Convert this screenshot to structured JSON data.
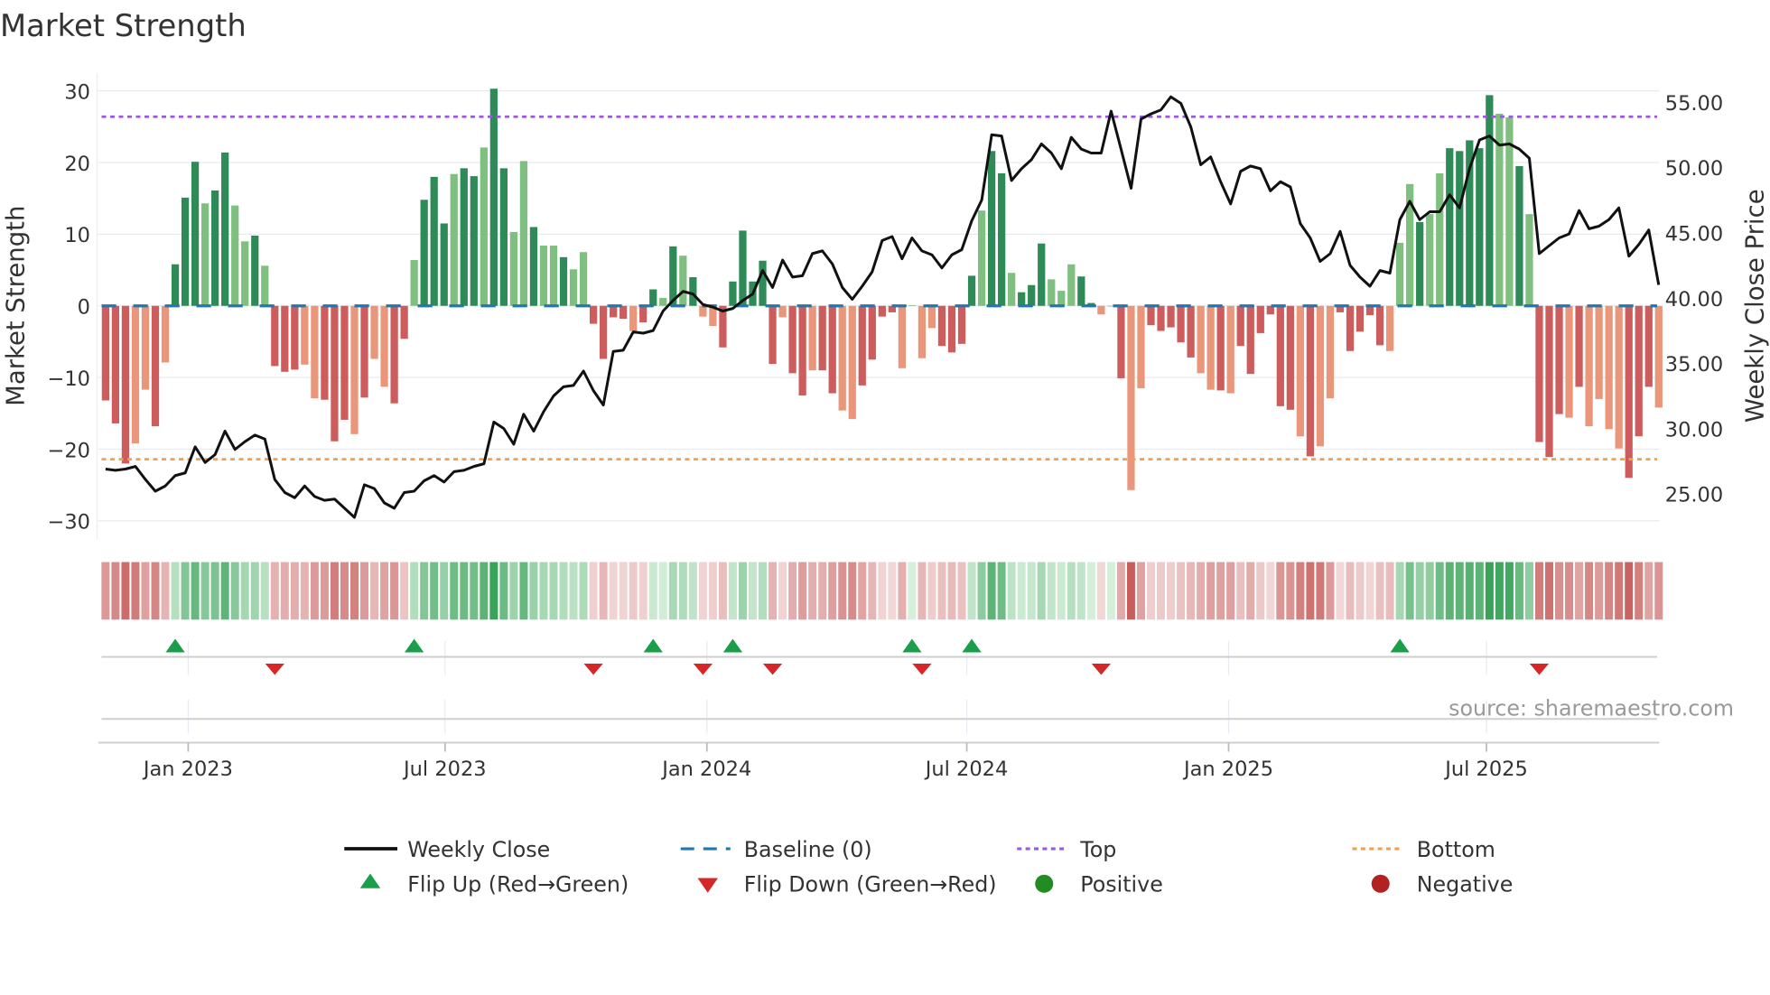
{
  "chart_data": {
    "type": "bar+line",
    "title": "Market Strength",
    "ylabel_left": "Market Strength",
    "ylabel_right": "Weekly Close Price",
    "ylim_left": [
      -32.5,
      33
    ],
    "ylim_right": [
      22.1,
      57.7
    ],
    "left_ticks": [
      {
        "value": 30,
        "label": "30"
      },
      {
        "value": 20,
        "label": "20"
      },
      {
        "value": 10,
        "label": "10"
      },
      {
        "value": 0,
        "label": "0"
      },
      {
        "value": -10,
        "label": "−10"
      },
      {
        "value": -20,
        "label": "−20"
      },
      {
        "value": -30,
        "label": "−30"
      }
    ],
    "right_ticks": [
      {
        "value": 55,
        "label": "55.00"
      },
      {
        "value": 50,
        "label": "50.00"
      },
      {
        "value": 45,
        "label": "45.00"
      },
      {
        "value": 40,
        "label": "40.00"
      },
      {
        "value": 35,
        "label": "35.00"
      },
      {
        "value": 30,
        "label": "30.00"
      },
      {
        "value": 25,
        "label": "25.00"
      }
    ],
    "x_ticks": [
      {
        "week": 8.3,
        "label": "Jan 2023"
      },
      {
        "week": 34.1,
        "label": "Jul 2023"
      },
      {
        "week": 60.4,
        "label": "Jan 2024"
      },
      {
        "week": 86.5,
        "label": "Jul 2024"
      },
      {
        "week": 112.8,
        "label": "Jan 2025"
      },
      {
        "week": 138.7,
        "label": "Jul 2025"
      }
    ],
    "top_level": 26.4,
    "bottom_level": -21.4,
    "baseline": 0,
    "strength": [
      -13.2,
      -16.4,
      -22.0,
      -19.2,
      -11.7,
      -16.8,
      -7.9,
      5.8,
      15.1,
      20.1,
      14.3,
      16.1,
      21.4,
      14.0,
      9.0,
      9.8,
      5.6,
      -8.4,
      -9.2,
      -8.9,
      -8.2,
      -12.9,
      -13.1,
      -18.9,
      -15.9,
      -17.9,
      -12.8,
      -7.4,
      -11.3,
      -13.6,
      -4.6,
      6.4,
      14.8,
      18.0,
      11.5,
      18.4,
      19.2,
      18.1,
      22.1,
      30.3,
      19.2,
      10.3,
      20.2,
      11.0,
      8.4,
      8.4,
      6.8,
      5.1,
      7.5,
      -2.5,
      -7.4,
      -1.6,
      -1.8,
      -3.5,
      -2.3,
      2.3,
      1.1,
      8.3,
      7.0,
      4.0,
      -1.5,
      -2.8,
      -5.8,
      3.4,
      10.5,
      3.4,
      6.3,
      -8.1,
      -1.6,
      -9.4,
      -12.5,
      -9.0,
      -9.0,
      -12.2,
      -14.6,
      -15.8,
      -11.1,
      -7.5,
      -1.5,
      -0.9,
      -8.7,
      0.1,
      -7.3,
      -3.1,
      -5.6,
      -6.5,
      -5.3,
      4.2,
      13.3,
      21.6,
      18.5,
      4.6,
      1.9,
      2.9,
      8.7,
      3.7,
      2.1,
      5.8,
      4.1,
      0.4,
      -1.2,
      0,
      -10.1,
      -25.7,
      -11.5,
      -2.7,
      -3.5,
      -3.0,
      -5.1,
      -7.2,
      -9.4,
      -11.7,
      -11.8,
      -12.2,
      -5.6,
      -9.5,
      -3.8,
      -1.2,
      -14.0,
      -14.5,
      -18.2,
      -21.0,
      -19.6,
      -12.9,
      -0.9,
      -6.3,
      -3.6,
      -1.3,
      -5.5,
      -6.3,
      8.8,
      17.0,
      11.7,
      12.8,
      18.5,
      22.0,
      21.6,
      23.1,
      22.0,
      29.4,
      26.8,
      26.3,
      19.5,
      12.8,
      -19.0,
      -21.1,
      -15.1,
      -15.6,
      -11.3,
      -16.8,
      -13.0,
      -17.2,
      -19.9,
      -24.0,
      -18.2,
      -11.3,
      -14.2
    ],
    "shade": "dddlldldddlddlldldddlldddldllddldddlddlddlldlldllddddlddldldllddddddlddlddllddddllllddddlddldddlllddlldlldddddlldlddddddldlldddddllldlldddddlldldddldlllldddldldlddddlld",
    "weekly_close": [
      26.9,
      26.8,
      26.9,
      27.1,
      26.1,
      25.2,
      25.6,
      26.4,
      26.6,
      28.6,
      27.4,
      28.0,
      29.8,
      28.4,
      29.0,
      29.5,
      29.2,
      26.1,
      25.1,
      24.7,
      25.6,
      24.8,
      24.5,
      24.6,
      23.9,
      23.2,
      25.7,
      25.4,
      24.3,
      23.9,
      25.1,
      25.2,
      26.0,
      26.4,
      25.9,
      26.7,
      26.8,
      27.1,
      27.3,
      30.5,
      30.0,
      28.8,
      31.1,
      29.8,
      31.3,
      32.5,
      33.2,
      33.3,
      34.4,
      32.9,
      31.8,
      35.9,
      36.0,
      37.4,
      37.3,
      37.5,
      39.0,
      39.8,
      40.5,
      40.3,
      39.5,
      39.3,
      39.0,
      39.2,
      39.8,
      40.3,
      42.1,
      40.8,
      42.9,
      41.6,
      41.7,
      43.4,
      43.6,
      42.6,
      40.8,
      39.9,
      40.9,
      42.0,
      44.4,
      44.7,
      43.0,
      44.6,
      43.6,
      43.3,
      42.3,
      43.3,
      43.7,
      45.9,
      47.5,
      52.5,
      52.4,
      49.0,
      49.9,
      50.6,
      51.8,
      51.1,
      49.9,
      52.3,
      51.4,
      51.1,
      51.1,
      54.3,
      51.4,
      48.4,
      53.7,
      54.1,
      54.4,
      55.4,
      54.9,
      53.1,
      50.2,
      50.8,
      48.9,
      47.2,
      49.7,
      50.1,
      49.9,
      48.2,
      48.9,
      48.5,
      45.7,
      44.6,
      42.8,
      43.4,
      45.1,
      42.5,
      41.6,
      40.9,
      42.1,
      41.9,
      46.0,
      47.4,
      46.0,
      46.6,
      46.6,
      47.9,
      46.9,
      49.9,
      52.1,
      52.4,
      51.7,
      51.8,
      51.4,
      50.7,
      43.4,
      44.0,
      44.6,
      44.9,
      46.7,
      45.3,
      45.5,
      46.0,
      46.9,
      43.2,
      44.1,
      45.2,
      41.0
    ],
    "flip_up_weeks": [
      7,
      31,
      55,
      63,
      81,
      87,
      130
    ],
    "flip_down_weeks": [
      17,
      49,
      60,
      67,
      82,
      100,
      144
    ],
    "legend": {
      "placement": "bottom",
      "items": [
        {
          "label": "Weekly Close"
        },
        {
          "label": "Baseline (0)"
        },
        {
          "label": "Top"
        },
        {
          "label": "Bottom"
        },
        {
          "label": "Flip Up (Red→Green)"
        },
        {
          "label": "Flip Down (Green→Red)"
        },
        {
          "label": "Positive"
        },
        {
          "label": "Negative"
        }
      ]
    },
    "source": "source: sharemaestro.com"
  },
  "colors": {
    "pos_dark": "#2e8b57",
    "pos_light": "#7fbf7f",
    "neg_dark": "#cd5c5c",
    "neg_light": "#e9967a",
    "baseline": "#1f77b4",
    "top": "#9b59e0",
    "bottom": "#f0a050",
    "flip_up": "#1a9e4a",
    "flip_down": "#d62728",
    "positive": "#228b22",
    "negative": "#b22222"
  }
}
